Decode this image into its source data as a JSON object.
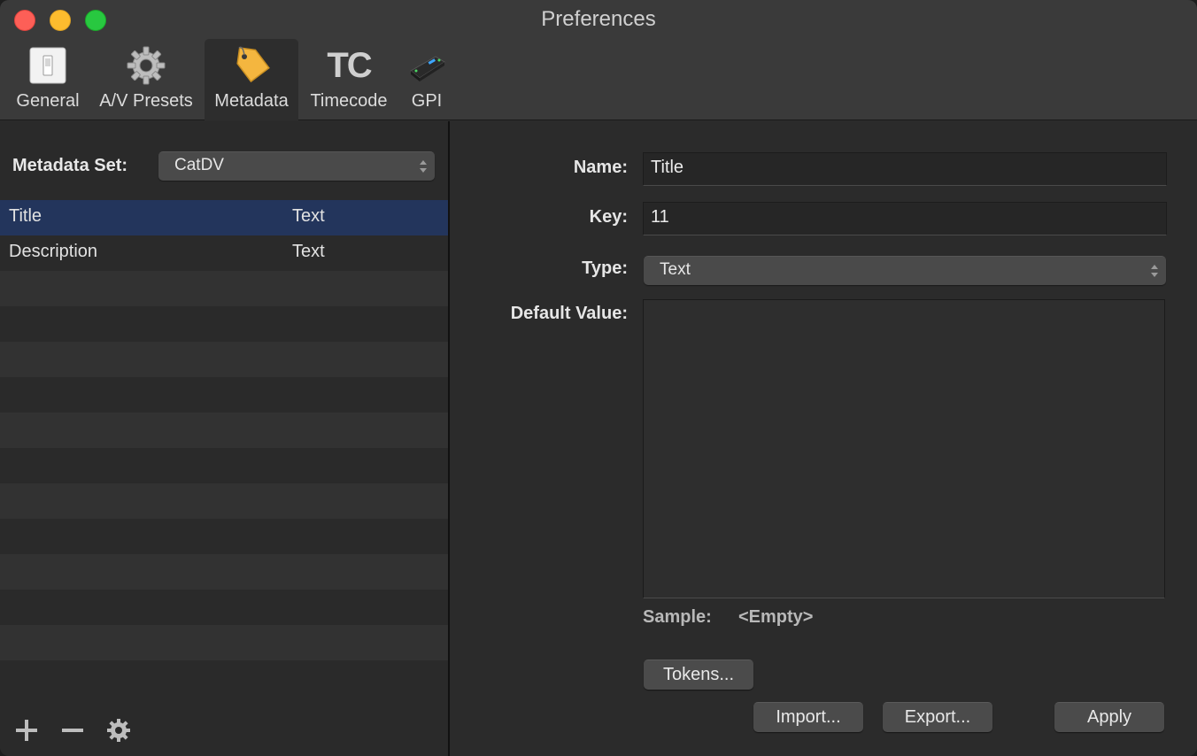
{
  "window": {
    "title": "Preferences"
  },
  "toolbar": {
    "items": [
      {
        "label": "General",
        "icon": "switch-icon"
      },
      {
        "label": "A/V Presets",
        "icon": "gear-icon"
      },
      {
        "label": "Metadata",
        "icon": "tag-icon",
        "selected": true
      },
      {
        "label": "Timecode",
        "icon": "tc-icon",
        "glyph": "TC"
      },
      {
        "label": "GPI",
        "icon": "gpi-device-icon"
      }
    ]
  },
  "left": {
    "set_label": "Metadata Set:",
    "set_value": "CatDV",
    "rows": [
      {
        "name": "Title",
        "type": "Text",
        "selected": true
      },
      {
        "name": "Description",
        "type": "Text"
      }
    ]
  },
  "right": {
    "name_label": "Name:",
    "name_value": "Title",
    "key_label": "Key:",
    "key_value": "11",
    "type_label": "Type:",
    "type_value": "Text",
    "default_label": "Default Value:",
    "sample_label": "Sample:",
    "sample_value": "<Empty>",
    "tokens_button": "Tokens...",
    "import_button": "Import...",
    "export_button": "Export...",
    "apply_button": "Apply"
  },
  "colors": {
    "selection": "#23355c",
    "row_alt": "#323232",
    "tag": "#f4b63f"
  }
}
